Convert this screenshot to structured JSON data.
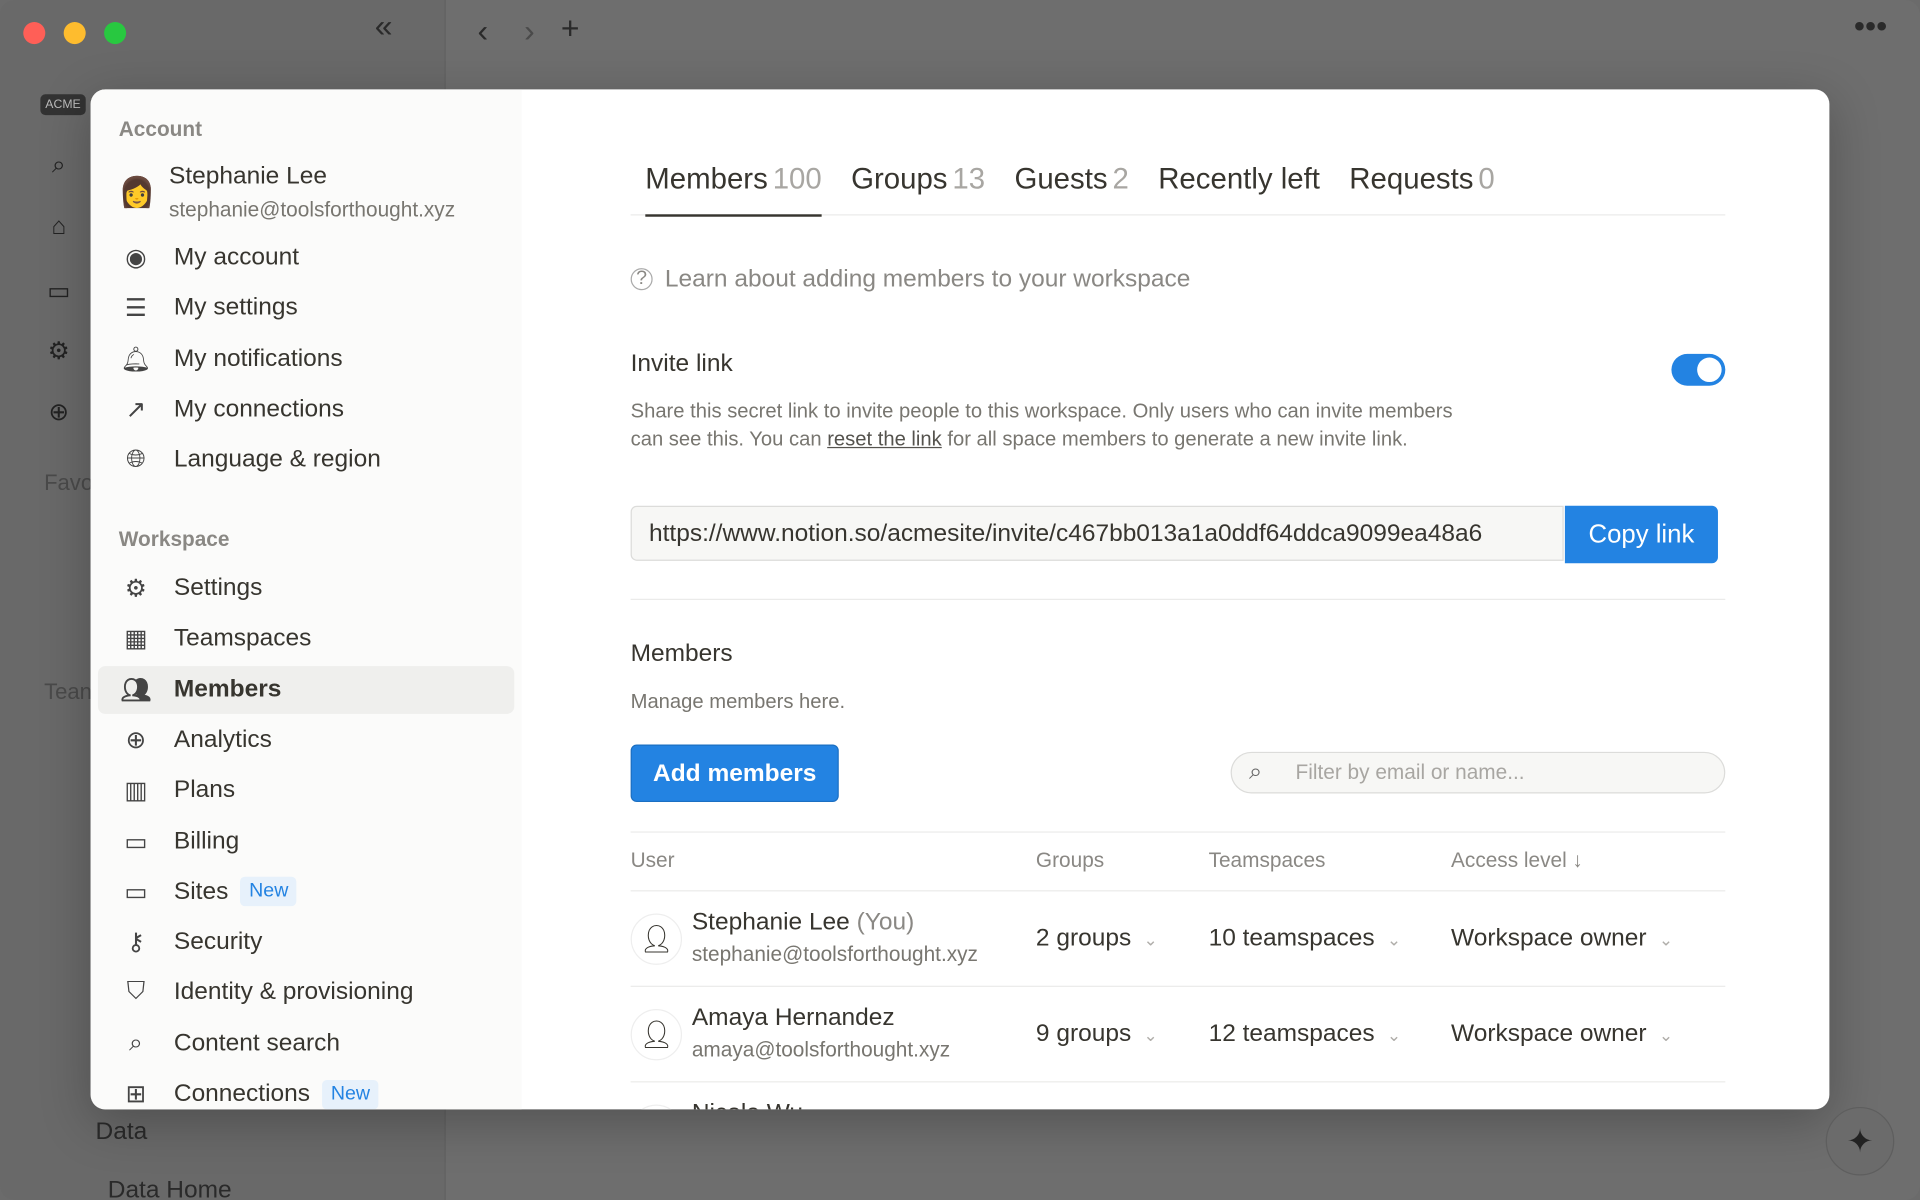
{
  "window": {
    "traffic_colors": [
      "#ff5f57",
      "#febc2e",
      "#28c840"
    ]
  },
  "background": {
    "workspace_logo": "ACME",
    "favorites_label": "Favo",
    "teamspaces_label": "Tean",
    "data_label": "Data",
    "data_home_label": "Data Home"
  },
  "nav": {
    "account_heading": "Account",
    "user_name": "Stephanie Lee",
    "user_email": "stephanie@toolsforthought.xyz",
    "account_items": [
      {
        "label": "My account",
        "icon": "user-circle-icon"
      },
      {
        "label": "My settings",
        "icon": "sliders-icon"
      },
      {
        "label": "My notifications",
        "icon": "bell-icon"
      },
      {
        "label": "My connections",
        "icon": "external-link-icon"
      },
      {
        "label": "Language & region",
        "icon": "globe-icon"
      }
    ],
    "workspace_heading": "Workspace",
    "workspace_items": [
      {
        "label": "Settings",
        "icon": "gear-icon"
      },
      {
        "label": "Teamspaces",
        "icon": "building-icon"
      },
      {
        "label": "Members",
        "icon": "people-icon",
        "active": true
      },
      {
        "label": "Analytics",
        "icon": "analytics-icon"
      },
      {
        "label": "Plans",
        "icon": "map-icon"
      },
      {
        "label": "Billing",
        "icon": "card-icon"
      },
      {
        "label": "Sites",
        "icon": "browser-icon",
        "badge": "New"
      },
      {
        "label": "Security",
        "icon": "key-icon"
      },
      {
        "label": "Identity & provisioning",
        "icon": "shield-icon"
      },
      {
        "label": "Content search",
        "icon": "search-icon"
      },
      {
        "label": "Connections",
        "icon": "grid-icon",
        "badge": "New"
      }
    ]
  },
  "tabs": [
    {
      "label": "Members",
      "count": "100",
      "active": true
    },
    {
      "label": "Groups",
      "count": "13"
    },
    {
      "label": "Guests",
      "count": "2"
    },
    {
      "label": "Recently left",
      "count": ""
    },
    {
      "label": "Requests",
      "count": "0"
    }
  ],
  "learn_link": "Learn about adding members to your workspace",
  "invite": {
    "title": "Invite link",
    "enabled": true,
    "desc_before": "Share this secret link to invite people to this workspace. Only users who can invite members can see this. You can ",
    "desc_link": "reset the link",
    "desc_after": " for all space members to generate a new invite link.",
    "url": "https://www.notion.so/acmesite/invite/c467bb013a1a0ddf64ddca9099ea48a6",
    "copy_label": "Copy link"
  },
  "members": {
    "title": "Members",
    "subtitle": "Manage members here.",
    "add_label": "Add members",
    "filter_placeholder": "Filter by email or name...",
    "columns": [
      "User",
      "Groups",
      "Teamspaces",
      "Access level ↓"
    ],
    "rows": [
      {
        "name": "Stephanie Lee",
        "you": "(You)",
        "email": "stephanie@toolsforthought.xyz",
        "groups": "2 groups",
        "teamspaces": "10 teamspaces",
        "access": "Workspace owner"
      },
      {
        "name": "Amaya Hernandez",
        "you": "",
        "email": "amaya@toolsforthought.xyz",
        "groups": "9 groups",
        "teamspaces": "12 teamspaces",
        "access": "Workspace owner"
      },
      {
        "name": "Nicole Wu",
        "you": "",
        "email": "",
        "groups": "",
        "teamspaces": "",
        "access": ""
      }
    ]
  }
}
